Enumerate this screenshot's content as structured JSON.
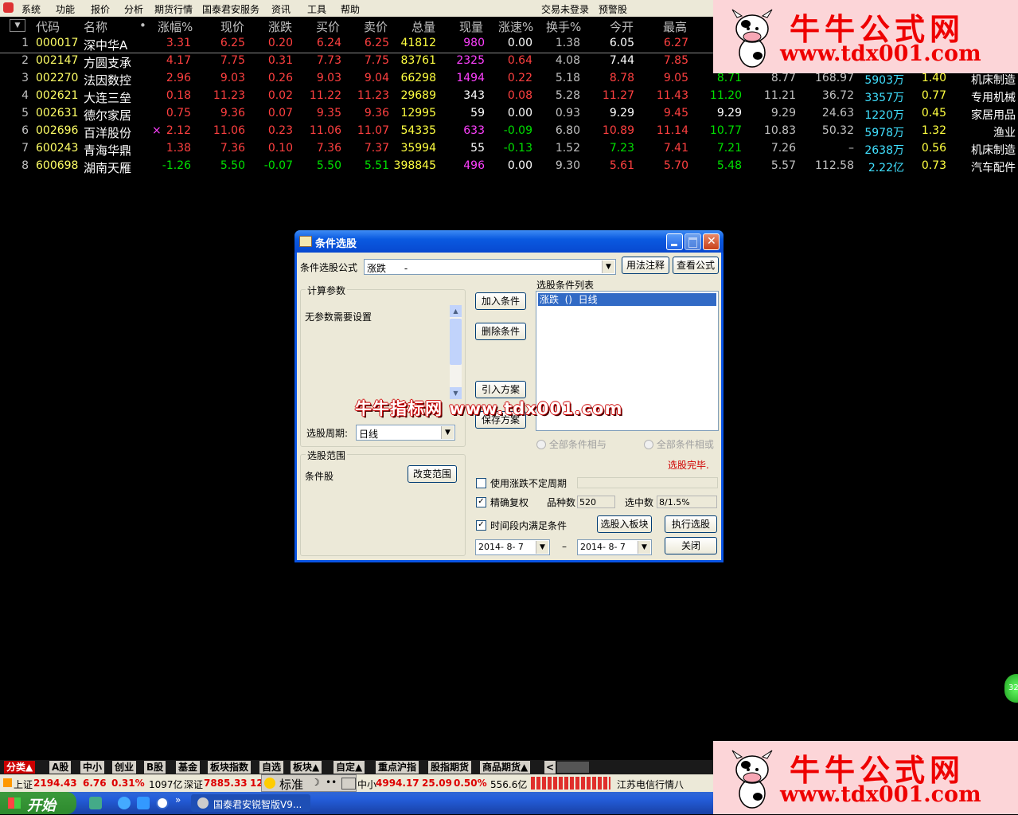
{
  "menu": {
    "items": [
      "系统",
      "功能",
      "报价",
      "分析",
      "期货行情",
      "国泰君安服务",
      "资讯",
      "工具",
      "帮助"
    ],
    "right": [
      "交易未登录",
      "预警股"
    ]
  },
  "table": {
    "headers": [
      "代码",
      "名称",
      "•",
      "涨幅%",
      "现价",
      "涨跌",
      "买价",
      "卖价",
      "总量",
      "现量",
      "涨速%",
      "换手%",
      "今开",
      "最高"
    ],
    "rows": [
      {
        "idx": "1",
        "code": "000017",
        "name": "深中华A",
        "mark": "",
        "chg_pct": "3.31",
        "price": "6.25",
        "chg": "0.20",
        "bid": "6.24",
        "ask": "6.25",
        "vol": "41812",
        "cur": "980",
        "speed": "0.00",
        "turn": "1.38",
        "open": "6.05",
        "high": "6.27",
        "low": "",
        "prev": "",
        "pe": "",
        "amount": "",
        "ratio": "",
        "industry": ""
      },
      {
        "idx": "2",
        "code": "002147",
        "name": "方圆支承",
        "mark": "",
        "chg_pct": "4.17",
        "price": "7.75",
        "chg": "0.31",
        "bid": "7.73",
        "ask": "7.75",
        "vol": "83761",
        "cur": "2325",
        "speed": "0.64",
        "turn": "4.08",
        "open": "7.44",
        "high": "7.85",
        "low": "",
        "prev": "",
        "pe": "",
        "amount": "",
        "ratio": "",
        "industry": ""
      },
      {
        "idx": "3",
        "code": "002270",
        "name": "法因数控",
        "mark": "",
        "chg_pct": "2.96",
        "price": "9.03",
        "chg": "0.26",
        "bid": "9.03",
        "ask": "9.04",
        "vol": "66298",
        "cur": "1494",
        "speed": "0.22",
        "turn": "5.18",
        "open": "8.78",
        "high": "9.05",
        "low": "8.71",
        "prev": "8.77",
        "pe": "168.97",
        "amount": "5903万",
        "ratio": "1.40",
        "industry": "机床制造"
      },
      {
        "idx": "4",
        "code": "002621",
        "name": "大连三垒",
        "mark": "",
        "chg_pct": "0.18",
        "price": "11.23",
        "chg": "0.02",
        "bid": "11.22",
        "ask": "11.23",
        "vol": "29689",
        "cur": "343",
        "speed": "0.08",
        "turn": "5.28",
        "open": "11.27",
        "high": "11.43",
        "low": "11.20",
        "prev": "11.21",
        "pe": "36.72",
        "amount": "3357万",
        "ratio": "0.77",
        "industry": "专用机械"
      },
      {
        "idx": "5",
        "code": "002631",
        "name": "德尔家居",
        "mark": "",
        "chg_pct": "0.75",
        "price": "9.36",
        "chg": "0.07",
        "bid": "9.35",
        "ask": "9.36",
        "vol": "12995",
        "cur": "59",
        "speed": "0.00",
        "turn": "0.93",
        "open": "9.29",
        "high": "9.45",
        "low": "9.29",
        "prev": "9.29",
        "pe": "24.63",
        "amount": "1220万",
        "ratio": "0.45",
        "industry": "家居用品"
      },
      {
        "idx": "6",
        "code": "002696",
        "name": "百洋股份",
        "mark": "×",
        "chg_pct": "2.12",
        "price": "11.06",
        "chg": "0.23",
        "bid": "11.06",
        "ask": "11.07",
        "vol": "54335",
        "cur": "633",
        "speed": "-0.09",
        "turn": "6.80",
        "open": "10.89",
        "high": "11.14",
        "low": "10.77",
        "prev": "10.83",
        "pe": "50.32",
        "amount": "5978万",
        "ratio": "1.32",
        "industry": "渔业"
      },
      {
        "idx": "7",
        "code": "600243",
        "name": "青海华鼎",
        "mark": "",
        "chg_pct": "1.38",
        "price": "7.36",
        "chg": "0.10",
        "bid": "7.36",
        "ask": "7.37",
        "vol": "35994",
        "cur": "55",
        "speed": "-0.13",
        "turn": "1.52",
        "open": "7.23",
        "high": "7.41",
        "low": "7.21",
        "prev": "7.26",
        "pe": "–",
        "amount": "2638万",
        "ratio": "0.56",
        "industry": "机床制造"
      },
      {
        "idx": "8",
        "code": "600698",
        "name": "湖南天雁",
        "mark": "",
        "chg_pct": "-1.26",
        "price": "5.50",
        "chg": "-0.07",
        "bid": "5.50",
        "ask": "5.51",
        "vol": "398845",
        "cur": "496",
        "speed": "0.00",
        "turn": "9.30",
        "open": "5.61",
        "high": "5.70",
        "low": "5.48",
        "prev": "5.57",
        "pe": "112.58",
        "amount": "2.22亿",
        "ratio": "0.73",
        "industry": "汽车配件"
      }
    ]
  },
  "ad": {
    "title": "牛牛公式网",
    "url": "www.tdx001.com"
  },
  "dialog": {
    "title": "条件选股",
    "formula_label": "条件选股公式",
    "formula_value": "涨跌      -",
    "usage_button": "用法注释",
    "view_formula_button": "查看公式",
    "params_group": "计算参数",
    "params_text": "无参数需要设置",
    "period_label": "选股周期:",
    "period_value": "日线",
    "add_button": "加入条件",
    "delete_button": "删除条件",
    "import_button": "引入方案",
    "save_button": "保存方案",
    "list_label": "选股条件列表",
    "list_items": [
      "涨跌  ()  日线"
    ],
    "radio_and": "全部条件相与",
    "radio_or": "全部条件相或",
    "done_text": "选股完毕.",
    "range_group": "选股范围",
    "range_value": "条件股",
    "change_range_button": "改变范围",
    "chk_variable_period": "使用涨跌不定周期",
    "chk_exact_adjust": "精确复权",
    "varieties_label": "品种数",
    "varieties_value": "520",
    "selected_label": "选中数",
    "selected_value": "8/1.5%",
    "chk_time_range": "时间段内满足条件",
    "to_block_button": "选股入板块",
    "execute_button": "执行选股",
    "date_from": "2014- 8- 7",
    "date_sep": "–",
    "date_to": "2014- 8- 7",
    "close_button": "关闭"
  },
  "watermark": "牛牛指标网 www.tdx001.com",
  "tabs": [
    "分类▲",
    "A股",
    "中小",
    "创业",
    "B股",
    "基金",
    "板块指数",
    "自选",
    "板块▲",
    "自定▲",
    "重点沪指",
    "股指期货",
    "商品期货▲"
  ],
  "status": {
    "sh_label": "上证",
    "sh_value": "2194.43",
    "sh_chg": "6.76",
    "sh_pct": "0.31%",
    "sh_amt": "1097亿",
    "sz_label": "深证",
    "sz_value": "7885.33",
    "sz_trunc": "12",
    "mode": "标准",
    "zx_label": "中小",
    "zx_value": "4994.17",
    "zx_chg": "25.09",
    "zx_pct": "0.50%",
    "zx_amt": "556.6亿",
    "ticker": "江苏电信行情八"
  },
  "taskbar": {
    "start": "开始",
    "window": "国泰君安锐智版V9...",
    "badge": "32"
  }
}
